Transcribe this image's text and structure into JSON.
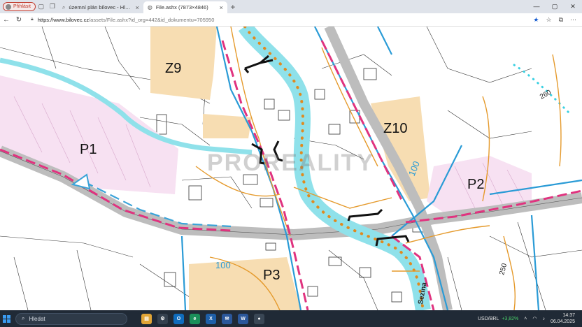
{
  "browser": {
    "profile_label": "Přihlásit",
    "tabs": [
      {
        "title": "územní plán bílovec - Hledat",
        "icon": "search-tab-icon"
      },
      {
        "title": "File.ashx (7873×4846)",
        "icon": "globe-icon",
        "active": true
      }
    ],
    "url_host": "https://www.bilovec.cz",
    "url_path": "/assets/File.ashx?id_org=442&id_dokumentu=705950"
  },
  "map": {
    "zones": {
      "z9": "Z9",
      "z10": "Z10",
      "p1": "P1",
      "p2": "P2",
      "p3": "P3"
    },
    "contours": {
      "c100a": "100",
      "c100b": "100",
      "c250": "250",
      "c260": "260"
    },
    "river_label": "Sezina",
    "watermark": "PROREALITY",
    "colors": {
      "zone_fill": "#f7ddb2",
      "pink_zone": "#f7e1f2",
      "road": "#bdbdbd",
      "blue_line": "#2a9bd6",
      "pink_dash": "#e0337f",
      "orange_line": "#e59a2c",
      "river": "#8fe1ea"
    }
  },
  "taskbar": {
    "search_placeholder": "Hledat",
    "ticker_symbol": "USD/BRL",
    "ticker_change": "+3,82%",
    "time": "14:37",
    "date": "06.04.2025"
  }
}
